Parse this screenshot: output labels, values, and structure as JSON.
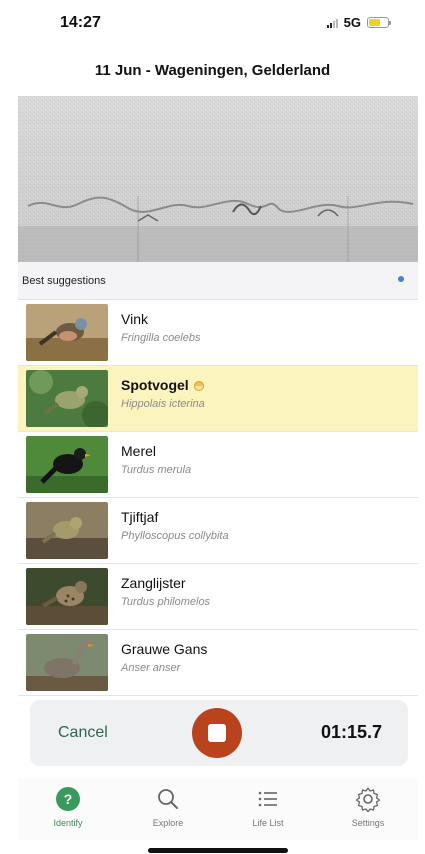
{
  "status_bar": {
    "time": "14:27",
    "network": "5G",
    "icons": [
      "signal-icon",
      "battery-icon"
    ]
  },
  "header": {
    "title": "11 Jun - Wageningen, Gelderland"
  },
  "suggestions": {
    "title": "Best suggestions",
    "items": [
      {
        "name": "Vink",
        "scientific": "Fringilla coelebs",
        "highlighted": false
      },
      {
        "name": "Spotvogel",
        "scientific": "Hippolais icterina",
        "highlighted": true,
        "badge": "half-filled-circle-icon"
      },
      {
        "name": "Merel",
        "scientific": "Turdus merula",
        "highlighted": false
      },
      {
        "name": "Tjiftjaf",
        "scientific": "Phylloscopus collybita",
        "highlighted": false
      },
      {
        "name": "Zanglijster",
        "scientific": "Turdus philomelos",
        "highlighted": false
      },
      {
        "name": "Grauwe Gans",
        "scientific": "Anser anser",
        "highlighted": false
      }
    ]
  },
  "recording": {
    "cancel_label": "Cancel",
    "timer": "01:15.7",
    "stop_icon": "stop-icon"
  },
  "tabs": [
    {
      "label": "Identify",
      "icon": "question-circle-icon",
      "active": true
    },
    {
      "label": "Explore",
      "icon": "search-icon",
      "active": false
    },
    {
      "label": "Life List",
      "icon": "list-icon",
      "active": false
    },
    {
      "label": "Settings",
      "icon": "gear-icon",
      "active": false
    }
  ],
  "colors": {
    "highlight": "#fbf4bf",
    "accent": "#3a8a5a",
    "record": "#b8431d",
    "live_dot": "#4a7fd6"
  }
}
